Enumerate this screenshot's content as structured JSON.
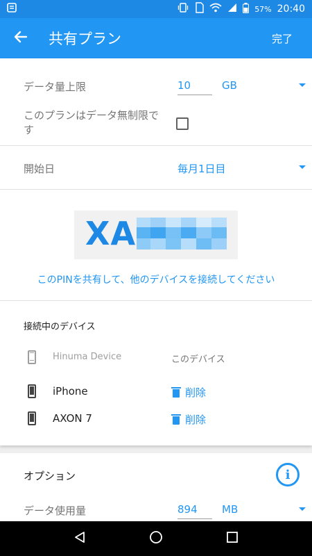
{
  "status_bar": {
    "battery_percent": "57%",
    "time": "20:40"
  },
  "app_bar": {
    "title": "共有プラン",
    "done_label": "完了"
  },
  "data_limit": {
    "label": "データ量上限",
    "value": "10",
    "unit": "GB"
  },
  "unlimited": {
    "label": "このプランはデータ無制限です",
    "checked": false
  },
  "start_date": {
    "label": "開始日",
    "value": "毎月1日目"
  },
  "pin": {
    "visible_prefix": "XA",
    "caption": "このPINを共有して、他のデバイスを接続してください"
  },
  "connected_devices": {
    "title": "接続中のデバイス",
    "this_device": {
      "name": "Hinuma Device",
      "label": "このデバイス"
    },
    "devices": [
      {
        "name": "iPhone",
        "action": "削除"
      },
      {
        "name": "AXON 7",
        "action": "削除"
      }
    ]
  },
  "options": {
    "title": "オプション",
    "data_usage": {
      "label": "データ使用量",
      "value": "894",
      "unit": "MB"
    }
  },
  "colors": {
    "primary": "#2196f3",
    "status_bar": "#1e88e5"
  }
}
